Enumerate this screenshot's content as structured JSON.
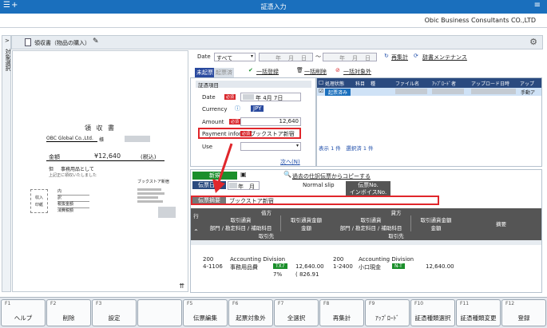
{
  "window": {
    "title": "証憑入力",
    "company": "Obic Business Consultants CO.,LTD",
    "plus": "+"
  },
  "sidetab": {
    "label": "対象選択",
    "arrow": ">"
  },
  "docbar": {
    "title": "領収書（物品の購入）"
  },
  "receipt": {
    "heading": "領 収 書",
    "to": "OBC Global Co.,Ltd.",
    "to_suffix": "様",
    "amount_label": "金額",
    "amount": "¥12,640",
    "tax": "(税込)",
    "note_label": "但",
    "note": "事務用品として",
    "received": "上記正に領収いたしました",
    "store": "ブックストア新宿",
    "stamp1": "収入",
    "stamp2": "印紙",
    "tbl_rows": [
      "内",
      "訳",
      "税抜金額",
      "消費税額"
    ]
  },
  "filter": {
    "date_label": "Date",
    "date_value": "すべて",
    "year": "年",
    "month": "月",
    "day": "日",
    "tilde": "〜",
    "recalc": "再集計",
    "maintenance": "辞書メンテナンス"
  },
  "tabs": {
    "unposted": "未起票",
    "posted": "起票済",
    "register_all": "一括登録",
    "delete_all": "一括削除",
    "exclude_all": "一括対象外"
  },
  "entry": {
    "section": "証憑項目",
    "date_label": "Date",
    "date_value": "年 4月 7日",
    "currency_label": "Currency",
    "currency_value": "JPY",
    "amount_label": "Amount",
    "amount_value": "12,640",
    "payment_label": "Payment infor",
    "payment_value": "ブックストア新宿",
    "use_label": "Use",
    "next": "次へ(N)",
    "required": "必須"
  },
  "grid": {
    "headers": [
      "処理状態",
      "科目",
      "種",
      "ファイル名",
      "ｱｯﾌﾟﾛｰﾄﾞ者",
      "アップロード日時",
      "アップ"
    ],
    "row_status": "起票済み",
    "row_last": "手動ア",
    "footer": "表示 1 件　選択済 1 件"
  },
  "lower": {
    "new": "新規",
    "slip_date": "伝票日付",
    "year": "年",
    "month": "月",
    "copy_link": "過去の仕訳伝票からコピーする",
    "normal_slip": "Normal slip",
    "slip_no": "伝票No.",
    "invoice_no": "インボイスNo.",
    "summary_label": "伝票摘要",
    "summary_value": "ブックストア新宿",
    "debit": "借方",
    "credit": "貸方",
    "h_account": "取引通貨",
    "h_amount": "取引通貨金額",
    "h_dept": "部門 / 勘定科目 / 補助科目",
    "h_money": "金額",
    "h_partner": "取引先",
    "h_memo": "摘要",
    "row": "行",
    "debit_row": {
      "code": "200",
      "acct": "4-1106",
      "div": "Accounting Division",
      "name": "事務用品費",
      "tax": "TX7",
      "rate": "7%",
      "amount": "12,640.00",
      "tax_amount": "( 826.91"
    },
    "credit_row": {
      "code": "200",
      "acct": "1-2400",
      "div": "Accounting Division",
      "name": "小口現金",
      "tax": "N-T",
      "amount": "12,640.00"
    }
  },
  "fkeys": [
    {
      "n": "F1",
      "l": "ヘルプ"
    },
    {
      "n": "F2",
      "l": "削除"
    },
    {
      "n": "F3",
      "l": "設定"
    },
    {
      "n": "",
      "l": ""
    },
    {
      "n": "F5",
      "l": "伝票編集"
    },
    {
      "n": "F6",
      "l": "起票対象外"
    },
    {
      "n": "F7",
      "l": "全選択"
    },
    {
      "n": "F8",
      "l": "再集計"
    },
    {
      "n": "F9",
      "l": "ｱｯﾌﾟﾛｰﾄﾞ"
    },
    {
      "n": "F10",
      "l": "証憑種類選択"
    },
    {
      "n": "F11",
      "l": "証憑種類変更"
    },
    {
      "n": "F12",
      "l": "登録"
    }
  ]
}
